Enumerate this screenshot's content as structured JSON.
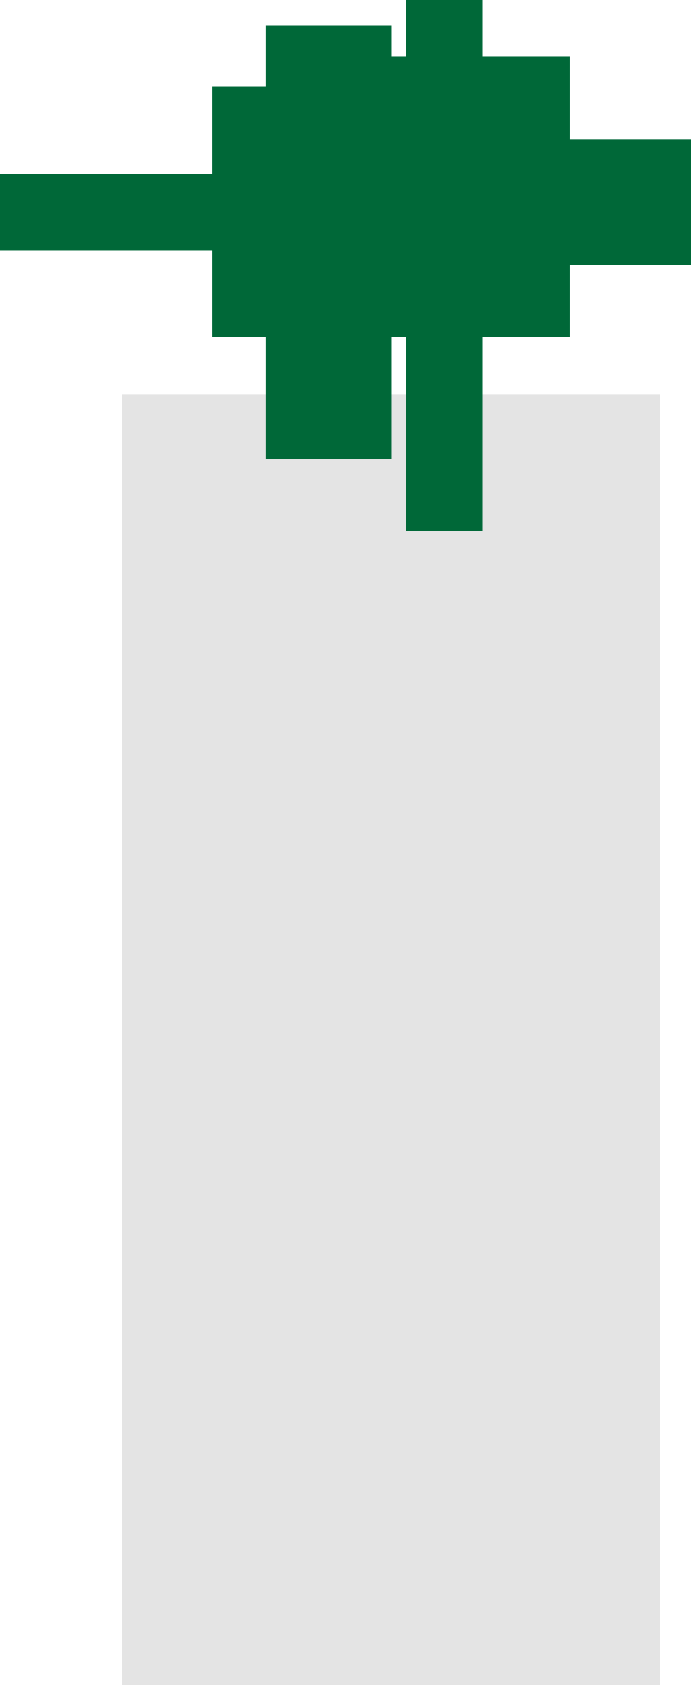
{
  "colors": {
    "background": "#ffffff",
    "panel": "#e4e4e4",
    "emblem": "#006838"
  },
  "icons": {
    "emblem": "pixel-cross-emblem-icon"
  }
}
